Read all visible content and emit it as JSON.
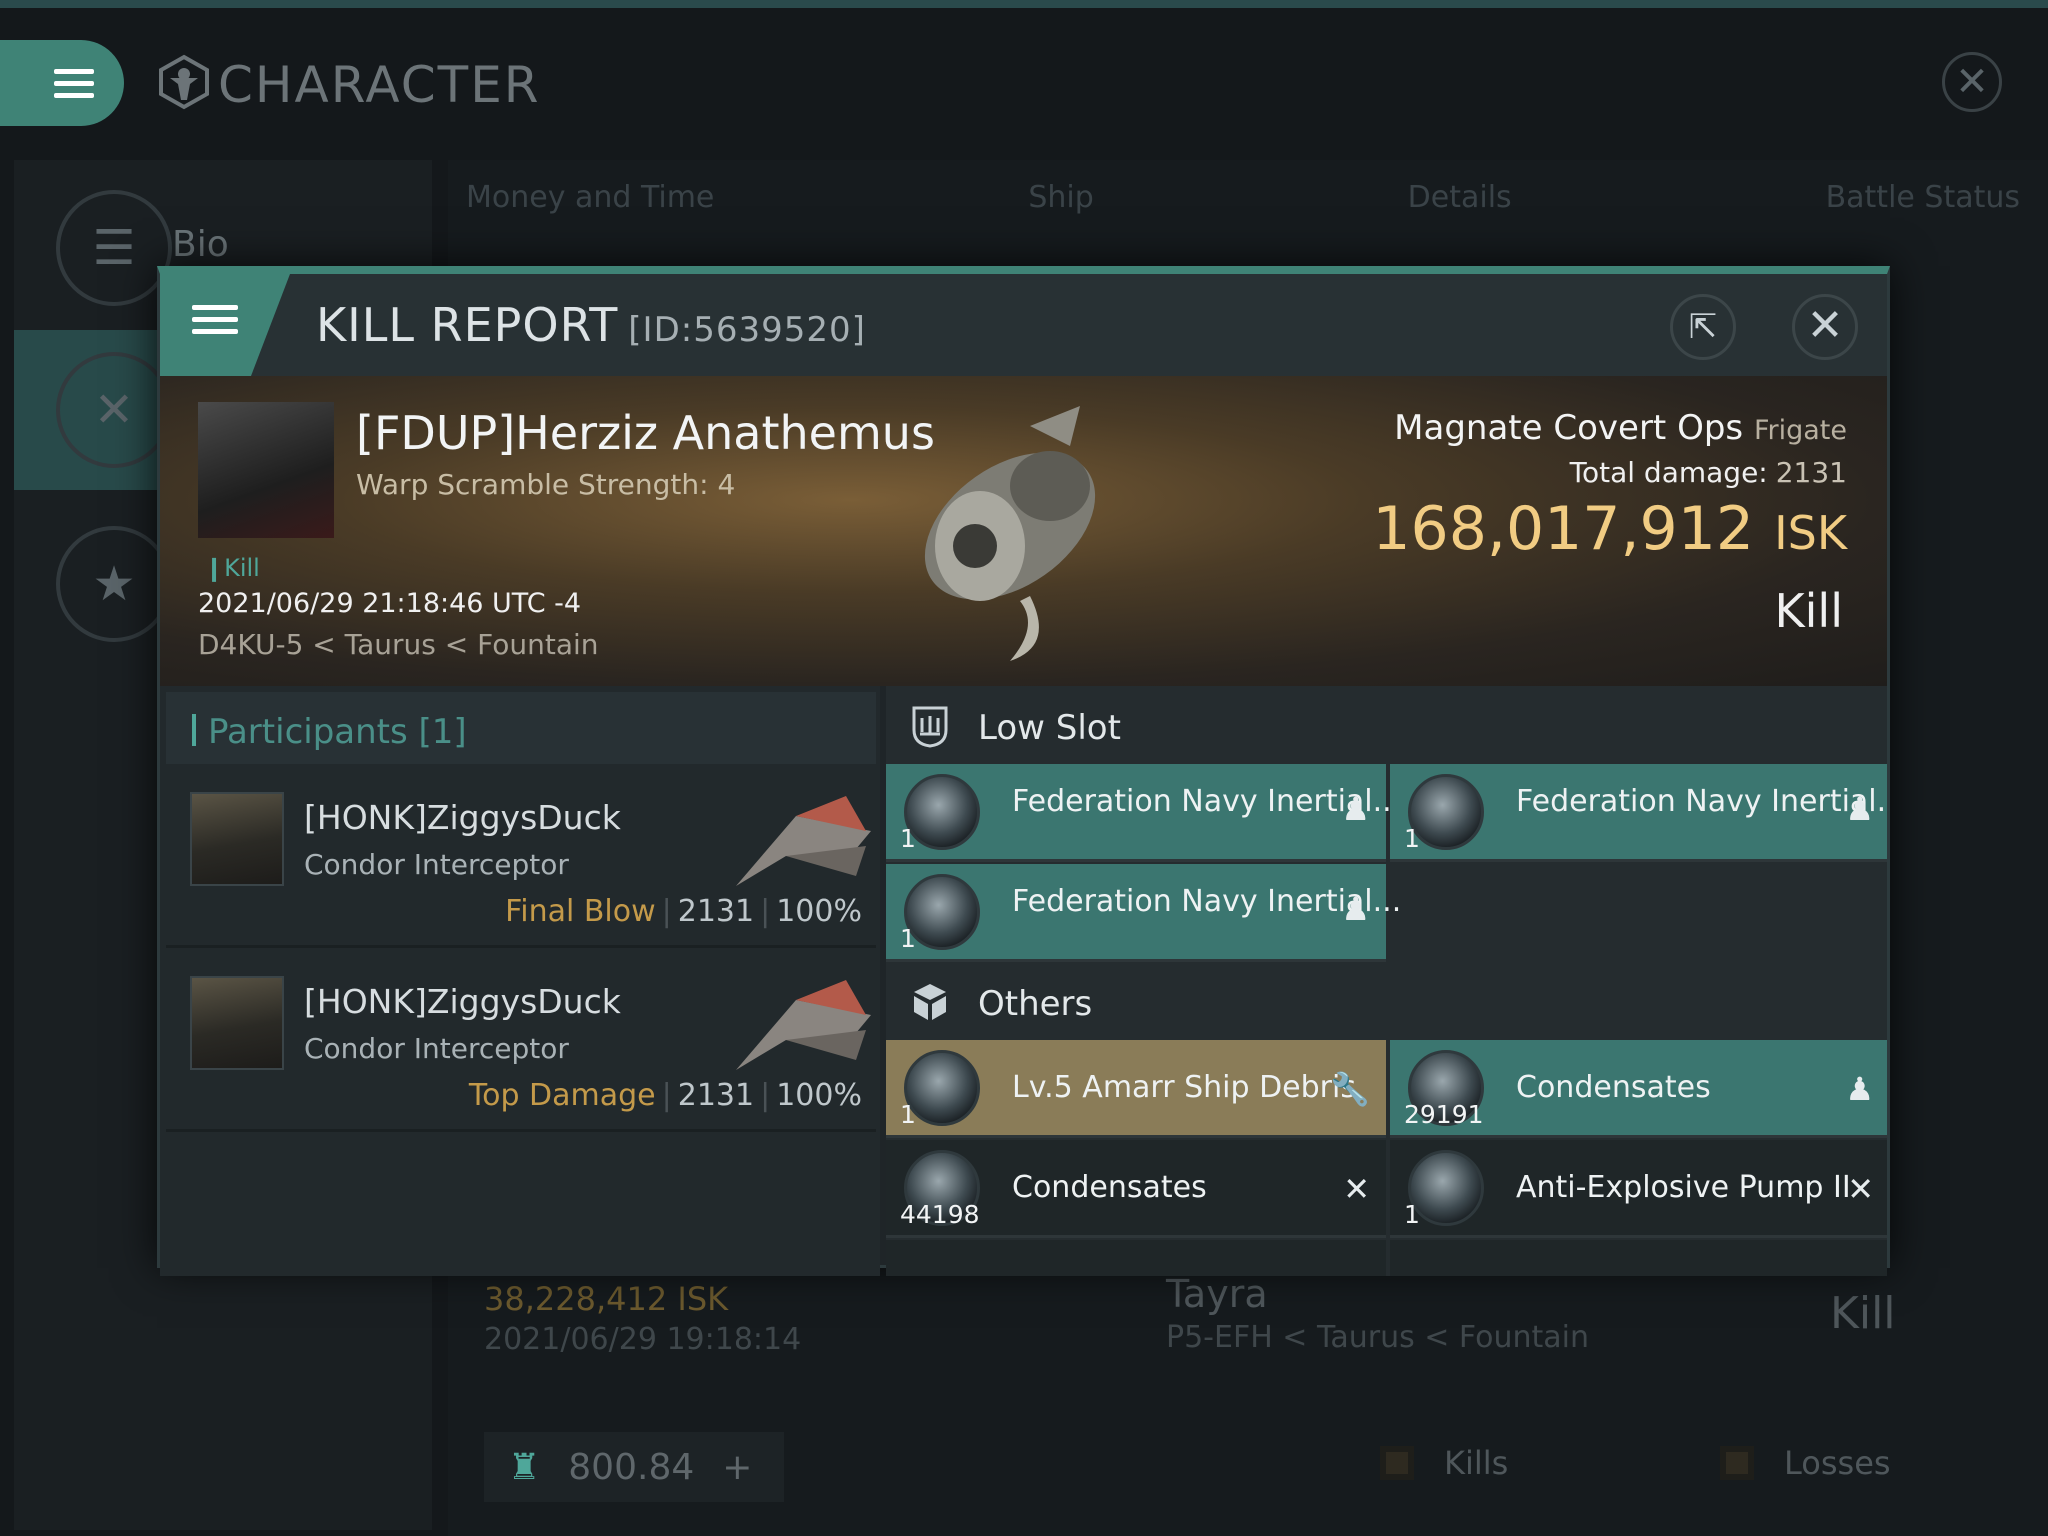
{
  "app": {
    "title": "CHARACTER",
    "sidebar": {
      "bio_label": "Bio"
    },
    "tabs": [
      "Money and Time",
      "Ship",
      "Details",
      "Battle Status"
    ],
    "bg_row": {
      "isk": "38,228,412 ISK",
      "date": "2021/06/29 19:18:14",
      "name": "Tayra",
      "location": "P5-EFH < Taurus < Fountain",
      "result": "Kill"
    },
    "footer": {
      "value": "800.84",
      "plus": "+"
    },
    "legend": {
      "kills": "Kills",
      "losses": "Losses"
    }
  },
  "modal": {
    "title": "KILL REPORT",
    "id": "[ID:5639520]",
    "victim": {
      "name": "[FDUP]Herziz Anathemus",
      "warp": "Warp Scramble Strength: 4",
      "tag": "Kill",
      "datetime": "2021/06/29 21:18:46 UTC -4",
      "location": "D4KU-5 < Taurus < Fountain"
    },
    "ship": {
      "name": "Magnate Covert Ops",
      "class": "Frigate",
      "total_damage_label": "Total damage:",
      "total_damage": "2131",
      "isk": "168,017,912",
      "isk_unit": "ISK",
      "result": "Kill"
    },
    "participants": {
      "header": "Participants",
      "count": "[1]",
      "list": [
        {
          "name": "[HONK]ZiggysDuck",
          "ship": "Condor Interceptor",
          "role": "Final Blow",
          "damage": "2131",
          "percent": "100%"
        },
        {
          "name": "[HONK]ZiggysDuck",
          "ship": "Condor Interceptor",
          "role": "Top Damage",
          "damage": "2131",
          "percent": "100%"
        }
      ]
    },
    "fitting": {
      "low_slot_label": "Low Slot",
      "others_label": "Others",
      "low_slot": [
        {
          "name": "Federation Navy Inertial...",
          "qty": "1",
          "flag": "person"
        },
        {
          "name": "Federation Navy Inertial...",
          "qty": "1",
          "flag": "person"
        },
        {
          "name": "Federation Navy Inertial...",
          "qty": "1",
          "flag": "person"
        }
      ],
      "others": [
        {
          "name": "Lv.5 Amarr Ship Debris",
          "qty": "1",
          "flag": "wrench"
        },
        {
          "name": "Condensates",
          "qty": "29191",
          "flag": "person"
        },
        {
          "name": "Condensates",
          "qty": "44198",
          "flag": "x"
        },
        {
          "name": "Anti-Explosive Pump II",
          "qty": "1",
          "flag": "x"
        }
      ]
    }
  },
  "colors": {
    "accent": "#3f8376",
    "gold": "#f1cc83",
    "dropped": "#3b7670",
    "special": "#8a7c58"
  }
}
